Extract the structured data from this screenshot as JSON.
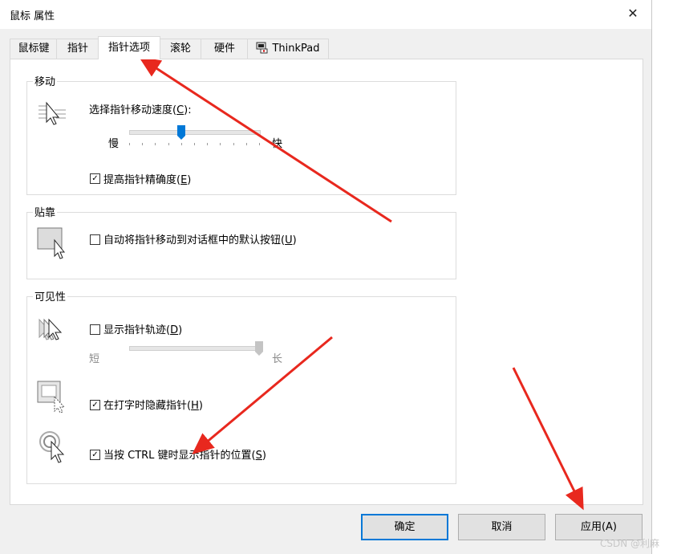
{
  "window": {
    "title": "鼠标 属性",
    "close": "✕"
  },
  "tabs": [
    {
      "label": "鼠标键"
    },
    {
      "label": "指针"
    },
    {
      "label": "指针选项"
    },
    {
      "label": "滚轮"
    },
    {
      "label": "硬件"
    },
    {
      "label": "ThinkPad"
    }
  ],
  "active_tab": "指针选项",
  "motion": {
    "group_label": "移动",
    "speed_label_pre": "选择指针移动速度(",
    "speed_key": "C",
    "speed_label_post": "):",
    "slow": "慢",
    "fast": "快",
    "speed_level": 0.4,
    "precision_checked": true,
    "precision_pre": "提高指针精确度(",
    "precision_key": "E",
    "precision_post": ")",
    "icon": "pointer-speed-icon"
  },
  "snap": {
    "group_label": "贴靠",
    "checked": false,
    "label_pre": "自动将指针移动到对话框中的默认按钮(",
    "label_key": "U",
    "label_post": ")",
    "icon": "snap-to-button-icon"
  },
  "visibility": {
    "group_label": "可见性",
    "trails_checked": false,
    "trails_pre": "显示指针轨迹(",
    "trails_key": "D",
    "trails_post": ")",
    "short": "短",
    "long": "长",
    "trails_level": 1.0,
    "hide_checked": true,
    "hide_pre": "在打字时隐藏指针(",
    "hide_key": "H",
    "hide_post": ")",
    "ctrl_checked": true,
    "ctrl_pre": "当按 CTRL 键时显示指针的位置(",
    "ctrl_key": "S",
    "ctrl_post": ")",
    "icons": [
      "pointer-trails-icon",
      "hide-while-typing-icon",
      "ctrl-locate-icon"
    ]
  },
  "buttons": {
    "ok": "确定",
    "cancel": "取消",
    "apply": "应用(A)"
  },
  "watermark": "CSDN @利麻",
  "colors": {
    "annotation_arrow": "#e8281e",
    "accent": "#0078d7",
    "slider_thumb": "#0078d7"
  }
}
